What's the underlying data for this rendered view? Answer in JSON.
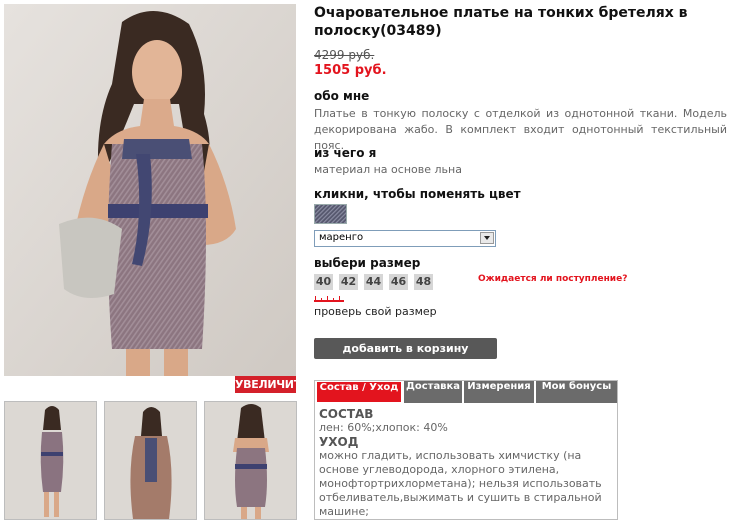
{
  "product": {
    "title": "Очаровательное платье на тонких бретелях в полоску(03489)",
    "old_price": "4299 руб.",
    "new_price": "1505 руб.",
    "zoom_label": "УВЕЛИЧИТЬ"
  },
  "about": {
    "heading": "обо мне",
    "text": "Платье в тонкую полоску с отделкой из однотонной ткани. Модель декорирована жабо. В комплект входит однотонный текстильный пояс."
  },
  "material": {
    "heading": "из чего я",
    "text": "материал на основе льна"
  },
  "color": {
    "heading": "кликни, чтобы поменять цвет",
    "selected": "маренго",
    "swatch_color": "#5d5f75"
  },
  "size": {
    "heading": "выбери размер",
    "options": [
      "40",
      "42",
      "44",
      "46",
      "48"
    ],
    "awaiting_link": "Ожидается ли поступление?",
    "check_size_link": "проверь свой размер"
  },
  "cart": {
    "add_label": "добавить в корзину"
  },
  "tabs": {
    "items": [
      "Состав / Уход",
      "Доставка",
      "Измерения",
      "Мои бонусы"
    ],
    "active_index": 0,
    "content": {
      "composition_heading": "СОСТАВ",
      "composition_text": "лен: 60%;хлопок: 40%",
      "care_heading": "УХОД",
      "care_text": "можно гладить, использовать химчистку (на основе углеводорода, хлорного этилена, монофтортрихлорметана); нельзя использовать отбеливатель,выжимать и сушить в стиральной машине;"
    }
  },
  "colors": {
    "accent": "#e3141e",
    "button_gray": "#585858",
    "tab_gray": "#6b6b6b"
  }
}
